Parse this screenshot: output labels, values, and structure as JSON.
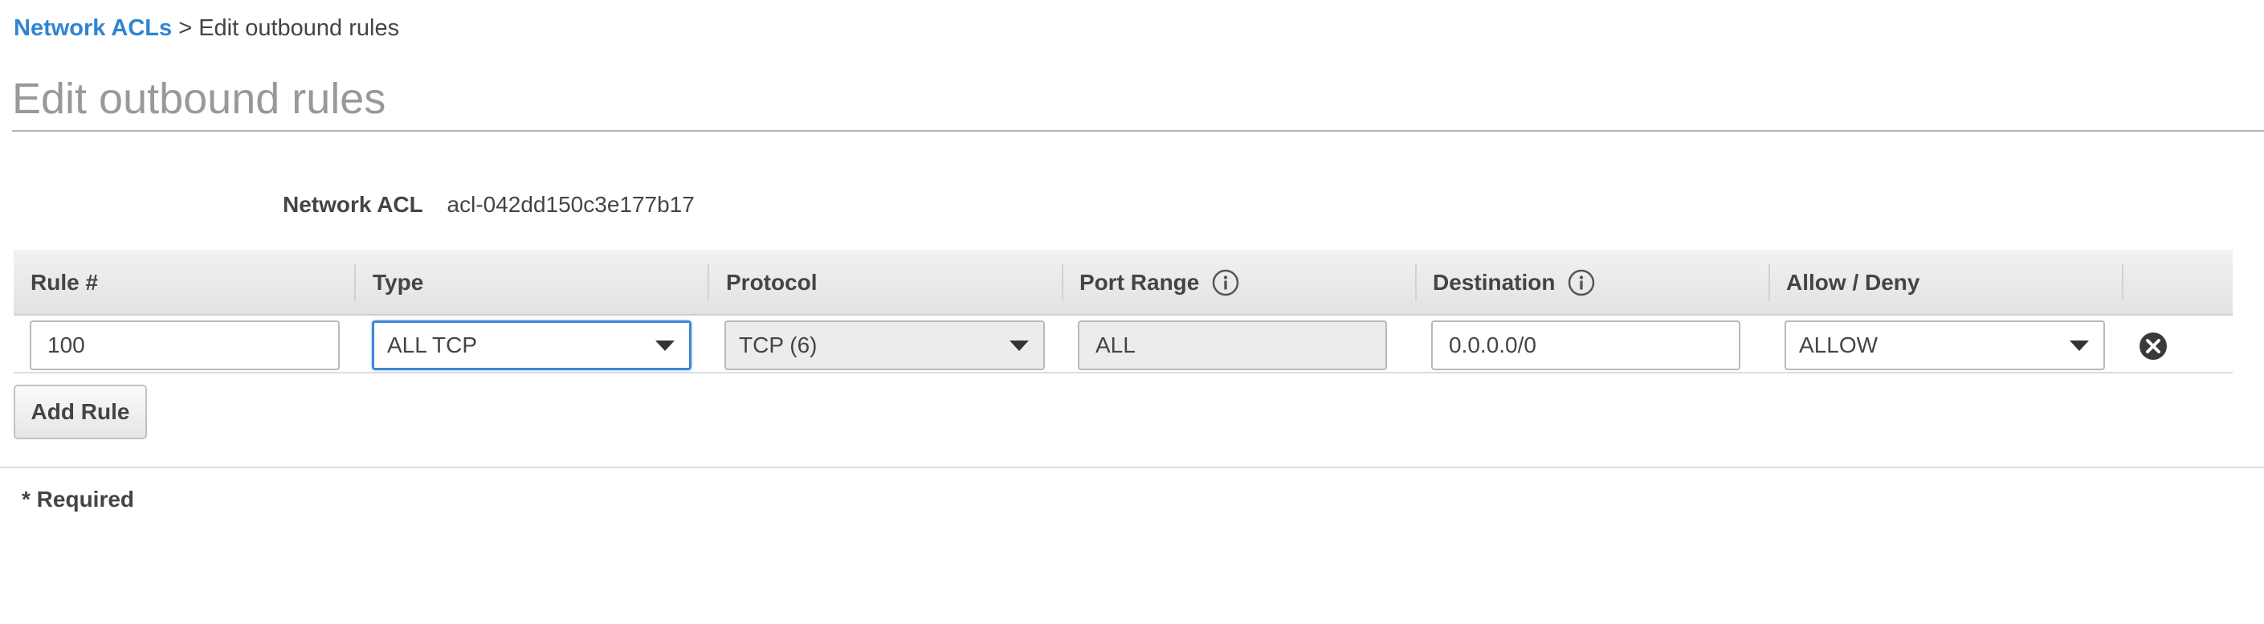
{
  "breadcrumb": {
    "parent": "Network ACLs",
    "separator": ">",
    "current": "Edit outbound rules"
  },
  "page_title": "Edit outbound rules",
  "network_acl": {
    "label": "Network ACL",
    "value": "acl-042dd150c3e177b17"
  },
  "table": {
    "columns": {
      "rule_number": "Rule #",
      "type": "Type",
      "protocol": "Protocol",
      "port_range": "Port Range",
      "destination": "Destination",
      "allow_deny": "Allow / Deny"
    },
    "rows": [
      {
        "rule_number": "100",
        "type": "ALL TCP",
        "protocol": "TCP (6)",
        "port_range": "ALL",
        "destination": "0.0.0.0/0",
        "allow_deny": "ALLOW"
      }
    ]
  },
  "add_rule_label": "Add Rule",
  "required_note": "* Required",
  "icons": {
    "info": "info-icon",
    "remove": "remove-circle-icon",
    "dropdown": "chevron-down-icon"
  },
  "colors": {
    "link": "#2f84d2",
    "focus_border": "#3a88d4",
    "title": "#999999"
  }
}
